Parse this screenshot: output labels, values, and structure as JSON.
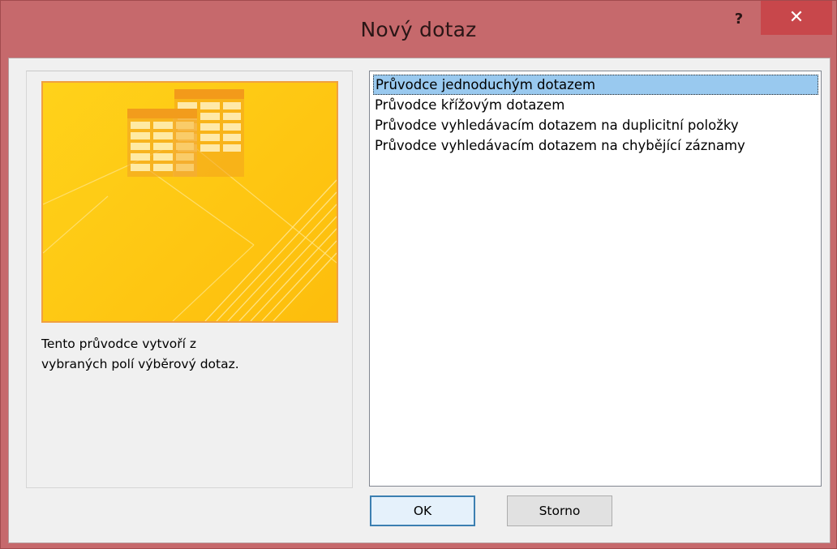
{
  "window": {
    "title": "Nový dotaz",
    "help_label": "?",
    "close_label": "✕"
  },
  "colors": {
    "titlebar": "#c6696c",
    "close_button": "#c8474b",
    "selection": "#99c9ef",
    "preview_gold": "#fec914"
  },
  "preview": {
    "icon": "query-wizard-illustration"
  },
  "description": {
    "line1": "Tento průvodce vytvoří z",
    "line2": "vybraných polí výběrový dotaz."
  },
  "wizards": {
    "items": [
      {
        "label": "Průvodce jednoduchým dotazem",
        "selected": true
      },
      {
        "label": "Průvodce křížovým dotazem",
        "selected": false
      },
      {
        "label": "Průvodce vyhledávacím dotazem na duplicitní položky",
        "selected": false
      },
      {
        "label": "Průvodce vyhledávacím dotazem na chybějící záznamy",
        "selected": false
      }
    ]
  },
  "buttons": {
    "ok_label": "OK",
    "cancel_label": "Storno"
  }
}
